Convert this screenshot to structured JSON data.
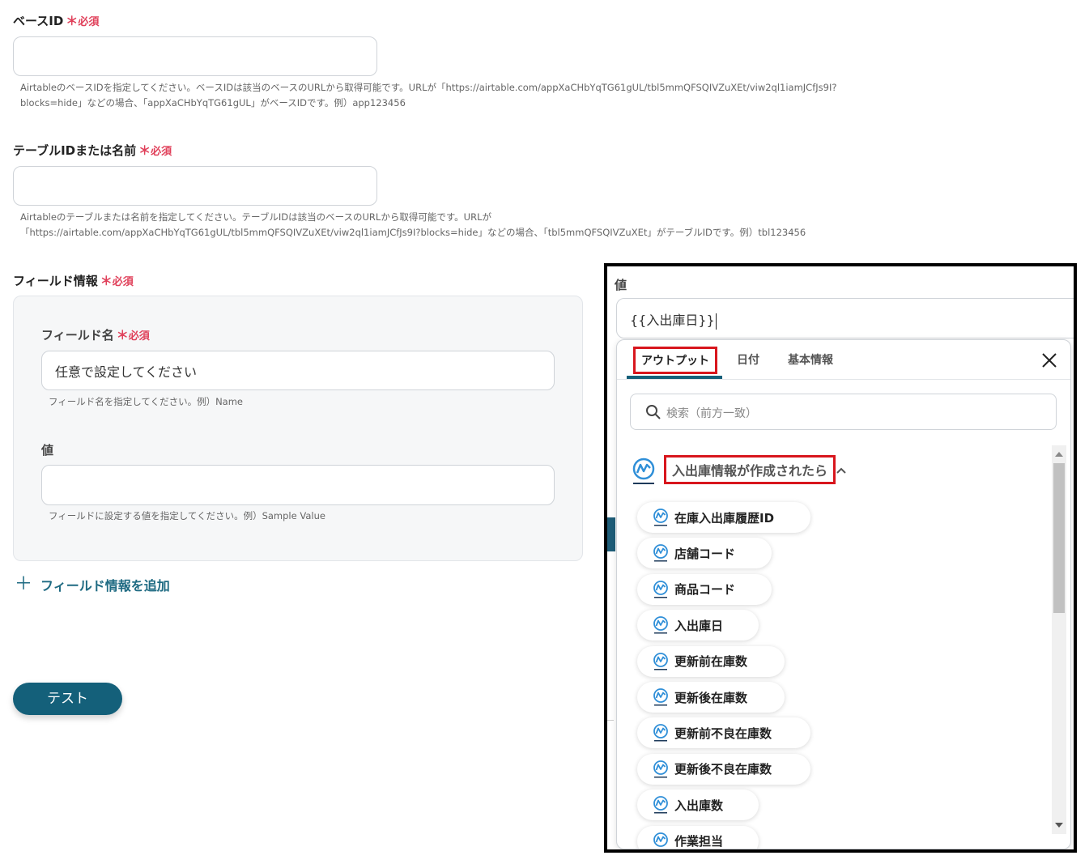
{
  "form": {
    "base_id": {
      "label": "ベースID",
      "req_star": "＊",
      "req_text": "必須",
      "help_line1": "AirtableのベースIDを指定してください。ベースIDは該当のベースのURLから取得可能です。URLが「https://airtable.com/appXaCHbYqTG61gUL/tbl5mmQFSQIVZuXEt/viw2ql1iamJCfJs9I?",
      "help_line2": "blocks=hide」などの場合、「appXaCHbYqTG61gUL」がベースIDです。例）app123456"
    },
    "table_id": {
      "label": "テーブルIDまたは名前",
      "req_star": "＊",
      "req_text": "必須",
      "help_line1": "Airtableのテーブルまたは名前を指定してください。テーブルIDは該当のベースのURLから取得可能です。URLが",
      "help_line2": "「https://airtable.com/appXaCHbYqTG61gUL/tbl5mmQFSQIVZuXEt/viw2ql1iamJCfJs9I?blocks=hide」などの場合、「tbl5mmQFSQIVZuXEt」がテーブルIDです。例）tbl123456"
    },
    "field_info": {
      "label": "フィールド情報",
      "req_star": "＊",
      "req_text": "必須",
      "field_name": {
        "label": "フィールド名",
        "req_star": "＊",
        "req_text": "必須",
        "value": "任意で設定してください",
        "help": "フィールド名を指定してください。例）Name"
      },
      "value": {
        "label": "値",
        "help": "フィールドに設定する値を指定してください。例）Sample Value"
      }
    },
    "add_field_label": "フィールド情報を追加",
    "add_field_icon": "plus-icon",
    "test_button": "テスト"
  },
  "overlay": {
    "value_label": "値",
    "value_input": "{{入出庫日}}",
    "tabs": [
      "アウトプット",
      "日付",
      "基本情報"
    ],
    "active_tab": 0,
    "search_placeholder": "検索（前方一致）",
    "group_title": "入出庫情報が作成されたら",
    "group_logo": "next-engine-logo",
    "items": [
      "在庫入出庫履歴ID",
      "店舗コード",
      "商品コード",
      "入出庫日",
      "更新前在庫数",
      "更新後在庫数",
      "更新前不良在庫数",
      "更新後不良在庫数",
      "入出庫数",
      "作業担当"
    ]
  },
  "colors": {
    "required": "#e0405a",
    "accent": "#14607a",
    "highlight_box": "#d8161d"
  }
}
